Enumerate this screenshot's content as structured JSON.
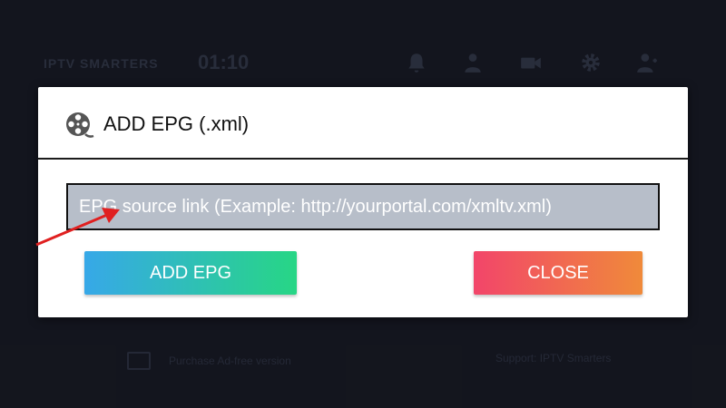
{
  "background_app": {
    "logo": "IPTV SMARTERS",
    "time": "01:10",
    "date": "",
    "header_icons": [
      "bell-icon",
      "user-icon",
      "video-icon",
      "gear-icon",
      "profile-icon"
    ],
    "footer_left": "Purchase Ad-free version",
    "footer_right": "Support: IPTV Smarters"
  },
  "dialog": {
    "title": "ADD EPG (.xml)",
    "title_icon": "film-reel-icon",
    "input": {
      "value": "",
      "placeholder": "EPG source link (Example: http://yourportal.com/xmltv.xml)"
    },
    "add_button_label": "ADD EPG",
    "close_button_label": "CLOSE"
  },
  "annotation": {
    "type": "arrow",
    "color": "#e02020"
  },
  "colors": {
    "add_gradient_start": "#37a8e8",
    "add_gradient_end": "#27d685",
    "close_gradient_start": "#f2456a",
    "close_gradient_end": "#f08a3a",
    "input_bg": "#b7bec9"
  }
}
